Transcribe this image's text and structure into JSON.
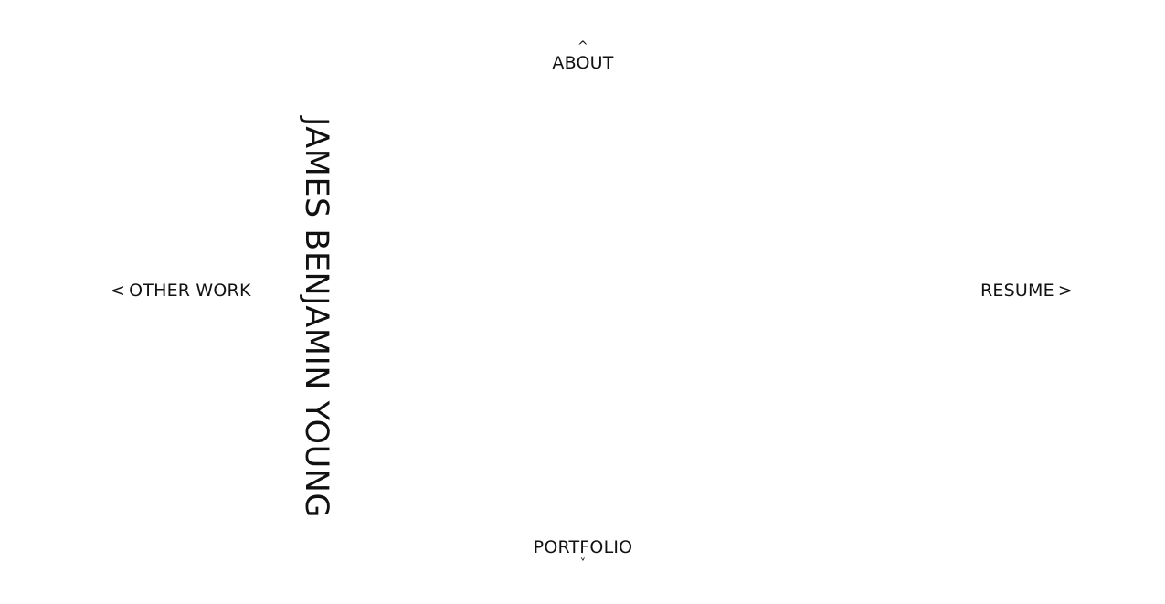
{
  "site": {
    "name": "JAMES BENJAMIN YOUNG"
  },
  "nav": {
    "up": {
      "label": "ABOUT",
      "arrow": "^",
      "icon": "caret-up-icon"
    },
    "down": {
      "label": "PORTFOLIO",
      "arrow": "˅",
      "icon": "caret-down-icon"
    },
    "left": {
      "label": "OTHER WORK",
      "arrow": "<",
      "icon": "chevron-left-icon"
    },
    "right": {
      "label": "RESUME",
      "arrow": ">",
      "icon": "chevron-right-icon"
    }
  },
  "colors": {
    "background": "#ffffff",
    "text": "#111111"
  }
}
